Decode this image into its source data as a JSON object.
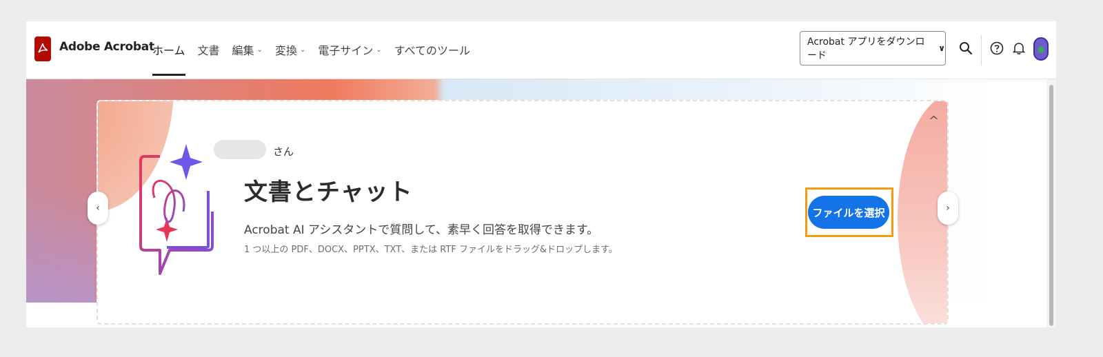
{
  "header": {
    "app_title": "Adobe Acrobat",
    "nav": [
      {
        "label": "ホーム",
        "dropdown": false,
        "active": true
      },
      {
        "label": "文書",
        "dropdown": false,
        "active": false
      },
      {
        "label": "編集",
        "dropdown": true,
        "active": false
      },
      {
        "label": "変換",
        "dropdown": true,
        "active": false
      },
      {
        "label": "電子サイン",
        "dropdown": true,
        "active": false
      },
      {
        "label": "すべてのツール",
        "dropdown": false,
        "active": false
      }
    ],
    "download_label": "Acrobat アプリをダウンロード",
    "icons": [
      "search-icon",
      "help-icon",
      "bell-icon",
      "avatar"
    ]
  },
  "card": {
    "user_suffix": "さん",
    "title": "文書とチャット",
    "description": "Acrobat AI アシスタントで質問して、素早く回答を取得できます。",
    "subtext": "1 つ以上の PDF、DOCX、PPTX、TXT、または RTF ファイルをドラッグ&ドロップします。",
    "select_button": "ファイルを選択"
  },
  "colors": {
    "brand_red": "#b30b00",
    "primary_blue": "#1473e6",
    "highlight_orange": "#f39c12"
  }
}
